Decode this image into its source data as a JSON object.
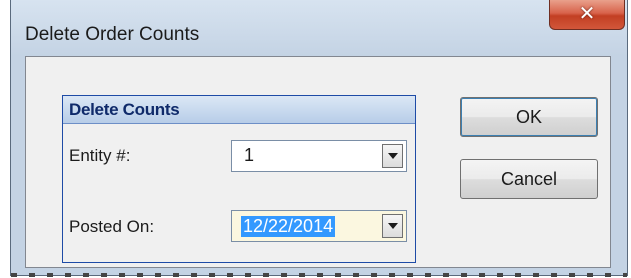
{
  "window": {
    "title": "Delete Order Counts",
    "close_icon": "close-icon"
  },
  "group": {
    "title": "Delete Counts",
    "fields": [
      {
        "label": "Entity #:",
        "value": "1"
      },
      {
        "label": "Posted On:",
        "value": "12/22/2014"
      }
    ]
  },
  "buttons": {
    "ok_label": "OK",
    "cancel_label": "Cancel"
  },
  "colors": {
    "window_frame": "#c4d3e4",
    "close_button": "#c23f23",
    "group_border": "#1e4ba6",
    "selection": "#3399ff"
  }
}
